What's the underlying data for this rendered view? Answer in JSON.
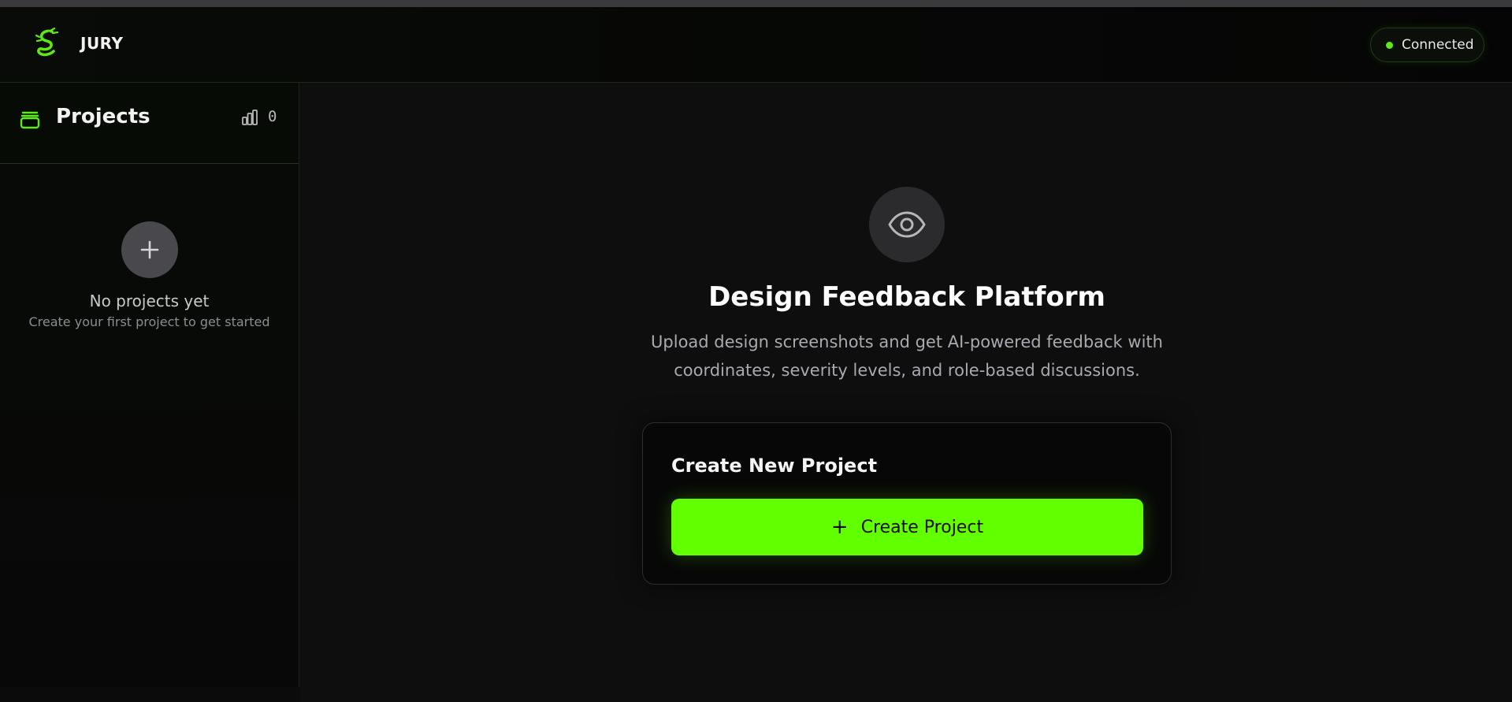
{
  "header": {
    "brand": "JURY",
    "status_label": "Connected",
    "status_color": "#5eea15",
    "logo_icon": "dragon-icon"
  },
  "sidebar": {
    "title": "Projects",
    "project_count": "0",
    "empty_title": "No projects yet",
    "empty_subtitle": "Create your first project to get started"
  },
  "main": {
    "hero_icon": "eye-icon",
    "title": "Design Feedback Platform",
    "description": "Upload design screenshots and get AI-powered feedback with coordinates, severity levels, and role-based discussions.",
    "card": {
      "title": "Create New Project",
      "button_label": "Create Project"
    }
  },
  "colors": {
    "accent": "#62ff00",
    "background": "#0e0e0e"
  }
}
